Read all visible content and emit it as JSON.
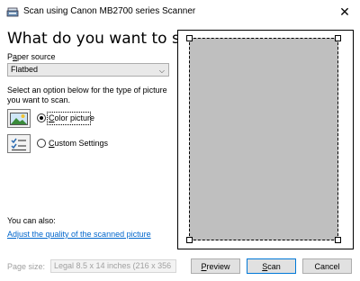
{
  "window": {
    "title": "Scan using Canon MB2700 series Scanner",
    "close_label": "✕"
  },
  "heading": "What do you want to scan?",
  "paper_source": {
    "label_prefix": "P",
    "label_underlined": "a",
    "label_suffix": "per source",
    "selected": "Flatbed",
    "chevron": "⌵"
  },
  "instructions": "Select an option below for the type of picture you want to scan.",
  "picture_types": [
    {
      "label_underlined": "C",
      "label_rest": "olor picture",
      "selected": true,
      "icon": "color-picture-icon"
    },
    {
      "label_underlined": "C",
      "label_rest": "ustom Settings",
      "selected": false,
      "icon": "custom-settings-icon"
    }
  ],
  "also": {
    "label": "You can also:",
    "link": "Adjust the quality of the scanned picture"
  },
  "page_size": {
    "label": "Page size:",
    "value": "Legal 8.5 x 14 inches (216 x 356"
  },
  "buttons": {
    "preview_underlined": "P",
    "preview_rest": "review",
    "scan_underlined": "S",
    "scan_rest": "can",
    "cancel": "Cancel"
  },
  "colors": {
    "link": "#0066cc",
    "scan_area": "#bfbfbf",
    "default_button_border": "#0078d7"
  }
}
